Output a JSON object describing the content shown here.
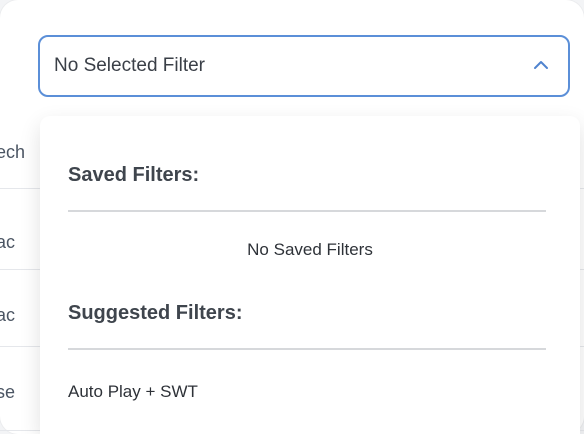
{
  "select": {
    "value": "No Selected Filter",
    "chevron_icon": "chevron-up-icon",
    "border_color": "#5b8fd8"
  },
  "background": {
    "row_texts": [
      "ech",
      "ac",
      "ac",
      "se"
    ]
  },
  "dropdown": {
    "saved": {
      "title": "Saved Filters:",
      "empty_text": "No Saved Filters"
    },
    "suggested": {
      "title": "Suggested Filters:",
      "items": [
        "Auto Play + SWT"
      ]
    }
  }
}
